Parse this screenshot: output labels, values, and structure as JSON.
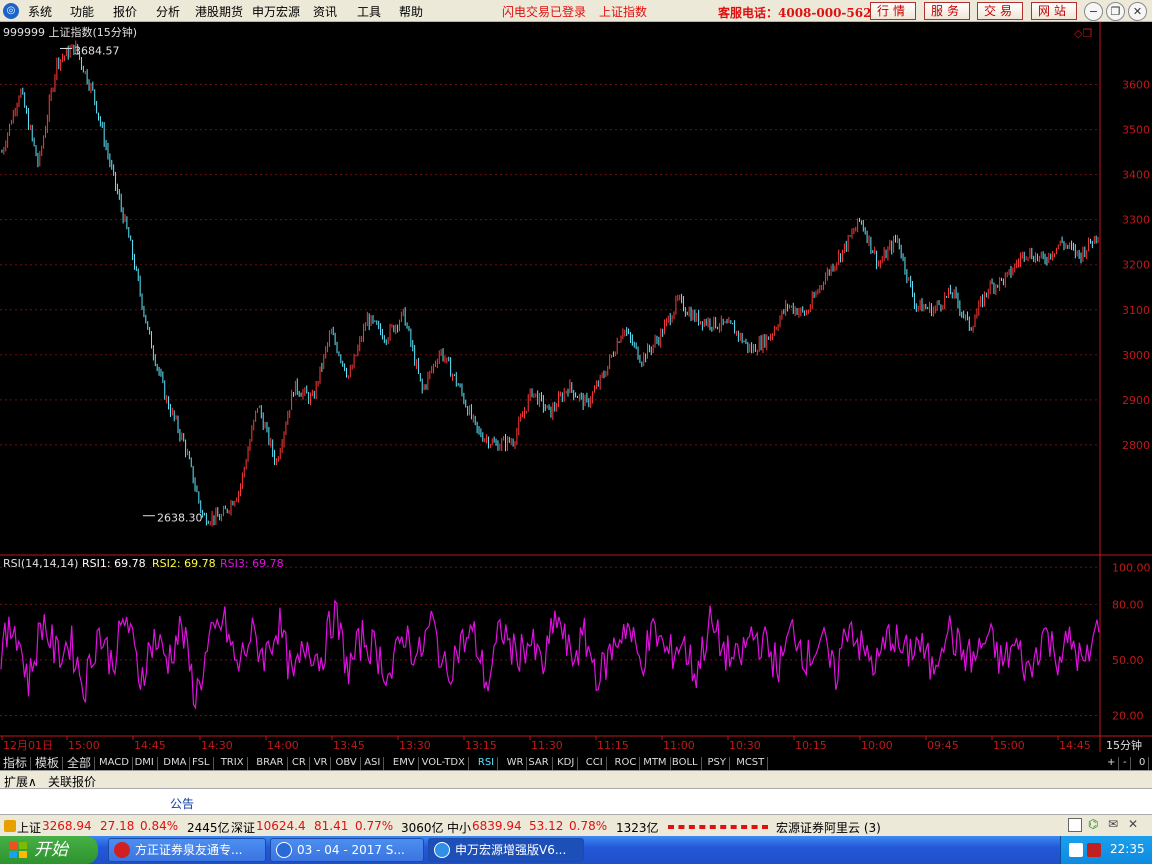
{
  "menu": {
    "items": [
      "系统",
      "功能",
      "报价",
      "分析",
      "港股期货",
      "申万宏源",
      "资讯",
      "工具",
      "帮助"
    ],
    "status1": "闪电交易已登录",
    "status2": "上证指数",
    "hotline": "客服电话：4008-000-562",
    "buttons": [
      "行情",
      "服务",
      "交易",
      "网站"
    ]
  },
  "chart": {
    "title": "999999 上证指数(15分钟)",
    "high_label": "3684.57",
    "low_label": "2638.30",
    "price_ticks": [
      "3600",
      "3500",
      "3400",
      "3300",
      "3200",
      "3100",
      "3000",
      "2900",
      "2800"
    ],
    "rsi_header": {
      "name": "RSI(14,14,14)",
      "rsi1": "RSI1: 69.78",
      "rsi2": "RSI2: 69.78",
      "rsi3": "RSI3: 69.78"
    },
    "rsi_ticks": [
      "100.00",
      "80.00",
      "50.00",
      "20.00"
    ],
    "time_labels": [
      "12月01日",
      "15:00",
      "14:45",
      "14:30",
      "14:00",
      "13:45",
      "13:30",
      "13:15",
      "11:30",
      "11:15",
      "11:00",
      "10:30",
      "10:15",
      "10:00",
      "09:45",
      "15:00",
      "14:45"
    ],
    "period": "15分钟"
  },
  "chart_data": {
    "type": "line",
    "title": "999999 上证指数(15分钟)",
    "ylim": [
      2560,
      3730
    ],
    "series": [
      {
        "name": "上证指数",
        "values": [
          3450,
          3590,
          3420,
          3650,
          3684.57,
          3580,
          3410,
          3250,
          3050,
          2900,
          2800,
          2640,
          2638.3,
          2700,
          2890,
          2760,
          2930,
          2900,
          3050,
          2950,
          3080,
          3040,
          3090,
          2920,
          3010,
          2930,
          2830,
          2800,
          2810,
          2920,
          2870,
          2930,
          2890,
          2960,
          3060,
          2990,
          3040,
          3120,
          3080,
          3070,
          3060,
          3010,
          3040,
          3110,
          3090,
          3170,
          3230,
          3300,
          3200,
          3260,
          3110,
          3100,
          3140,
          3060,
          3150,
          3170,
          3230,
          3210,
          3250,
          3220,
          3270
        ]
      }
    ],
    "rsi": {
      "ylim": [
        10,
        105
      ],
      "series": [
        {
          "name": "RSI3",
          "color": "#e010e0",
          "values": [
            55,
            70,
            38,
            72,
            52,
            60,
            35,
            66,
            48,
            74,
            40,
            62,
            50,
            68,
            30,
            58,
            72,
            45,
            64,
            52,
            70,
            38,
            60,
            50,
            76,
            44,
            62,
            55,
            40,
            66,
            50,
            71,
            42,
            58,
            64,
            36,
            68,
            52,
            60,
            46,
            74,
            50,
            62,
            40,
            56,
            70,
            48,
            66,
            52,
            60,
            42,
            70,
            55,
            48,
            64,
            58,
            46,
            68,
            50,
            62,
            40,
            72,
            54,
            47,
            65,
            52,
            60,
            44,
            69,
            55,
            50,
            63,
            48,
            58,
            42,
            66,
            52,
            60,
            45,
            70
          ]
        }
      ]
    }
  },
  "tabs": [
    "指标",
    "模板",
    "全部",
    "MACD",
    "DMI",
    "DMA",
    "FSL",
    "TRIX",
    "BRAR",
    "CR",
    "VR",
    "OBV",
    "ASI",
    "EMV",
    "VOL-TDX",
    "RSI",
    "WR",
    "SAR",
    "KDJ",
    "CCI",
    "ROC",
    "MTM",
    "BOLL",
    "PSY",
    "MCST"
  ],
  "selected_tab": "RSI",
  "tab_right": [
    "+",
    "-",
    "0"
  ],
  "sub_tabs": [
    "扩展∧",
    "关联报价"
  ],
  "notice": "公告",
  "status": {
    "sh_name": "上证",
    "sh_val": "3268.94",
    "sh_chg": "27.18",
    "sh_pct": "0.84%",
    "sh_amt": "2445亿",
    "sz_name": "深证",
    "sz_val": "10624.4",
    "sz_chg": "81.41",
    "sz_pct": "0.77%",
    "sz_amt": "3060亿",
    "zx_name": "中小",
    "zx_val": "6839.94",
    "zx_chg": "53.12",
    "zx_pct": "0.78%",
    "zx_amt": "1323亿",
    "broker": "宏源证券阿里云 (3)"
  },
  "taskbar": {
    "start": "开始",
    "items": [
      "方正证券泉友通专...",
      "03 - 04 - 2017 S...",
      "申万宏源增强版V6..."
    ],
    "clock": "22:35"
  },
  "colors": {
    "up": "#ff3a3a",
    "down": "#5fe9ff",
    "rsi": "#e010e0",
    "axis": "#c01818",
    "rsi2": "#ffff40"
  }
}
